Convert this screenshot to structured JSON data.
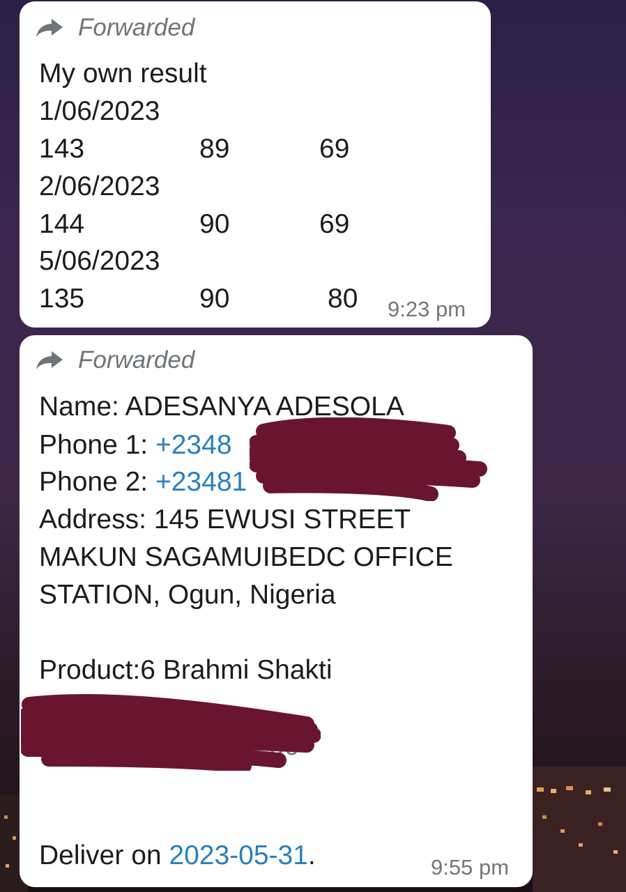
{
  "messages": [
    {
      "forwarded_label": "Forwarded",
      "title": "My own result",
      "entries": [
        {
          "date": "1/06/2023",
          "values": [
            "143",
            "89",
            "69"
          ]
        },
        {
          "date": "2/06/2023",
          "values": [
            "144",
            "90",
            "69"
          ]
        },
        {
          "date": "5/06/2023",
          "values": [
            "135",
            "90",
            "80"
          ]
        }
      ],
      "time": "9:23 pm"
    },
    {
      "forwarded_label": "Forwarded",
      "name_line": "Name: ADESANYA ADESOLA",
      "phone1_label": "Phone 1: ",
      "phone1_value": "+2348",
      "phone2_label": "Phone 2: ",
      "phone2_value": "+23481",
      "address_lines": [
        "Address: 145 EWUSI STREET",
        "MAKUN SAGAMUIBEDC OFFICE",
        "STATION, Ogun, Nigeria"
      ],
      "product_line": "Product:6 Brahmi Shakti",
      "redacted_tail": "00",
      "deliver_label": "Deliver on ",
      "deliver_date": "2023-05-31",
      "deliver_suffix": ".",
      "time": "9:55 pm"
    }
  ],
  "colors": {
    "link": "#2a80b9",
    "bubble": "#ffffff",
    "redaction": "#6a1530"
  },
  "icons": {
    "forward": "forward-arrow-icon"
  }
}
